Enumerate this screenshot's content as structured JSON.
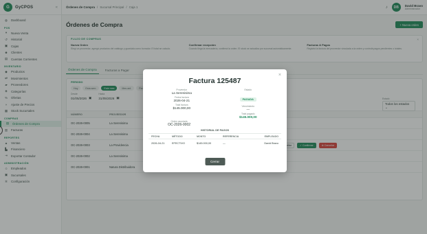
{
  "brand": {
    "name": "GyCPOS"
  },
  "sidebar": {
    "dashboard": "Dashboard",
    "sections": [
      {
        "title": "POS",
        "items": [
          "Nueva Venta",
          "Historial",
          "Cajas",
          "Clientes",
          "Cuentas Corrientes"
        ]
      },
      {
        "title": "INVENTARIO",
        "items": [
          "Productos",
          "Movimientos",
          "Proveedores",
          "Categorías",
          "Ofertas",
          "Ajuste de Precios",
          "Stock Sucursales"
        ]
      },
      {
        "title": "COMPRAS",
        "items": [
          "Órdenes de Compra",
          "Facturas"
        ]
      },
      {
        "title": "REPORTES",
        "items": [
          "Ventas",
          "Financiero",
          "Exportar Contador"
        ]
      },
      {
        "title": "ADMINISTRACIÓN",
        "items": [
          "Empleados",
          "Sucursales",
          "Configuración"
        ]
      }
    ]
  },
  "topbar": {
    "breadcrumbs": [
      "Órdenes de Compra",
      "/",
      "Sucursal Principal",
      "/",
      "Caja 1"
    ],
    "avatar_initials": "DB",
    "user_name": "David Bravo",
    "user_role": "Administrador"
  },
  "page": {
    "title": "Órdenes de Compra",
    "new_button": "Nueva orden"
  },
  "flow": {
    "heading": "FLUJO DE COMPRAS",
    "steps": [
      {
        "title": "Nueva Orden",
        "desc": "Elegí un proveedor, agregá productos del catálogo y guardala como borrador. El total se calcula."
      },
      {
        "title": "Confirmar recepción",
        "desc": "Cuando llega la mercadería, confirmá la orden. El stock se actualiza por sucursal automáticamente."
      },
      {
        "title": "Facturas & Pagos",
        "desc": "Registrá la factura del proveedor vinculada a la orden y controlá pagos pendientes o totales."
      }
    ]
  },
  "tabs": [
    "Órdenes de Compra",
    "Facturas a Pagar"
  ],
  "filters": {
    "periodo_label": "PERIODO",
    "chips": [
      "Hoy",
      "Esta sem.",
      "Este mes",
      "Mes ant.",
      "Personal"
    ],
    "desde_label": "Desde",
    "desde": "01/05/2026",
    "hasta_label": "Hasta",
    "hasta": "31/05/2026",
    "estado_label": "Estado",
    "estado_value": "Todos los estados"
  },
  "table": {
    "headers": [
      "NÚMERO",
      "PROVEEDOR",
      "",
      "",
      "",
      "",
      "ACCIONES"
    ],
    "rows": [
      {
        "num": "OC-2026-0005",
        "prov": "La Serenisima",
        "suc": "",
        "fecha": "",
        "total": "",
        "estado": "PENDIENTE",
        "actions": [
          "Ver"
        ]
      },
      {
        "num": "OC-2026-0004",
        "prov": "La Serenisima",
        "suc": "",
        "fecha": "",
        "total": "",
        "estado": "PAGADA",
        "actions": [
          "Ver"
        ]
      },
      {
        "num": "OC-2026-0003",
        "prov": "La Providencia",
        "suc": "",
        "fecha": "",
        "total": "",
        "estado": "",
        "actions": [
          "Ver",
          "Editar",
          "Confirmar",
          "Cancelar"
        ]
      },
      {
        "num": "OC-2026-0002",
        "prov": "La Serenisima",
        "suc": "",
        "fecha": "",
        "total": "",
        "estado": "PAGADA",
        "actions": [
          "Ver"
        ]
      },
      {
        "num": "OC-2026-0001",
        "prov": "Natura Distribuidora",
        "suc": "Sucursal Principal",
        "fecha": "25/04/2026",
        "total": "$73.000,00",
        "estado": "RECIBIDA",
        "estado2": "Registrar",
        "actions": [
          "Ver"
        ]
      }
    ]
  },
  "modal": {
    "title": "Factura 125487",
    "proveedor_label": "Proveedor",
    "proveedor": "La Serenisima",
    "estado_label": "Estado",
    "estado": "PAGADA",
    "fecha_label": "Fecha factura",
    "fecha": "2026-04-21",
    "venc_label": "Vencimiento",
    "venc": "—",
    "total_label": "Total factura",
    "total": "$145.000,00",
    "pagado_label": "Total pagado",
    "pagado": "$145.000,00",
    "orden_label": "Orden asociada",
    "orden": "OC-2026-0002",
    "hist_title": "HISTORIAL DE PAGOS",
    "hist_headers": [
      "FECHA",
      "MÉTODO",
      "MONTO",
      "REFERENCIA",
      "EMPLEADO"
    ],
    "hist_rows": [
      [
        "2026-04-21",
        "EFECTIVO",
        "$145.000,00",
        "—",
        "David Bravo"
      ]
    ],
    "close_button": "Cerrar"
  },
  "colors": {
    "primary": "#1f8a5b",
    "danger": "#d9433b",
    "pending": "#e05c3a"
  }
}
